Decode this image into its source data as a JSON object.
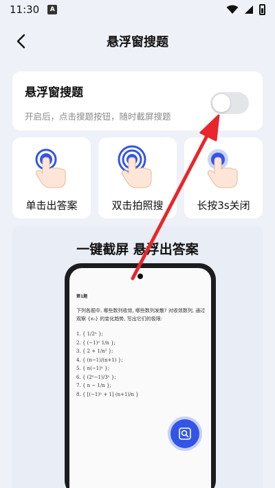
{
  "status_bar": {
    "time": "11:30",
    "app_badge": "A"
  },
  "header": {
    "title": "悬浮窗搜题"
  },
  "toggle_card": {
    "title": "悬浮窗搜题",
    "description": "开启后，点击搜题按钮，随时截屏搜题",
    "enabled": false
  },
  "modes": [
    {
      "label": "单击出答案",
      "icon": "single-tap-icon"
    },
    {
      "label": "双击拍照搜",
      "icon": "double-tap-icon"
    },
    {
      "label": "长按3s关闭",
      "icon": "long-press-icon"
    }
  ],
  "demo": {
    "title": "一键截屏 悬浮出答案",
    "question_number": "第1题",
    "question_text": "下列各题中, 哪些数列收敛, 哪些数列发散? 对收敛数列, 通过观察 {xₙ} 的变化趋势, 写出它们的极限:",
    "items": [
      "1.  { 1/2ⁿ };",
      "2.  { (−1)ⁿ 1/n };",
      "3.  { 2 + 1/n² };",
      "4.  { (n−1)/(n+1) };",
      "5.  { n(−1)ⁿ };",
      "6.  { (2ⁿ−1)/3ⁿ };",
      "7.  { n − 1/n };",
      "8.  { [(−1)ⁿ + 1] (n+1)/n }"
    ]
  },
  "colors": {
    "accent": "#3355e6",
    "arrow": "#e8262b",
    "background": "#eef1f8",
    "card": "#ffffff"
  }
}
